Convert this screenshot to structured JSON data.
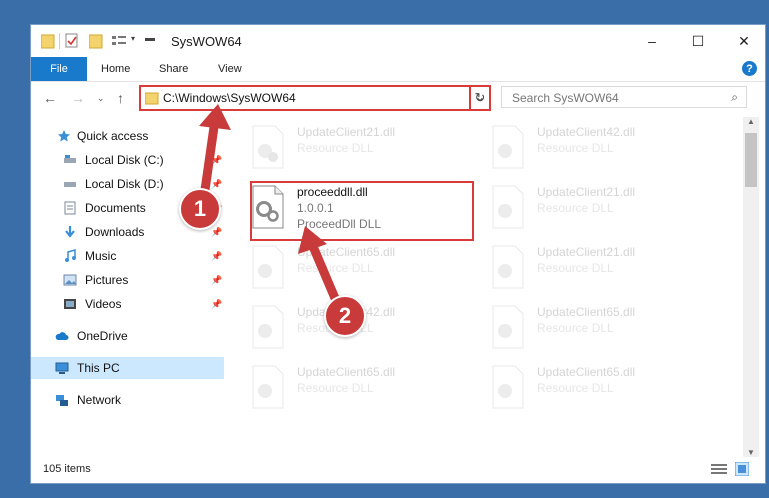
{
  "window": {
    "title": "SysWOW64",
    "minimize": "–",
    "maximize": "☐",
    "close": "✕"
  },
  "ribbon": {
    "file": "File",
    "home": "Home",
    "share": "Share",
    "view": "View",
    "help": "?"
  },
  "address": {
    "path": "C:\\Windows\\SysWOW64",
    "search_placeholder": "Search SysWOW64"
  },
  "sidebar": {
    "items": [
      {
        "label": "Quick access"
      },
      {
        "label": "Local Disk (C:)"
      },
      {
        "label": "Local Disk (D:)"
      },
      {
        "label": "Documents"
      },
      {
        "label": "Downloads"
      },
      {
        "label": "Music"
      },
      {
        "label": "Pictures"
      },
      {
        "label": "Videos"
      },
      {
        "label": "OneDrive"
      },
      {
        "label": "This PC"
      },
      {
        "label": "Network"
      }
    ]
  },
  "files": {
    "left": [
      {
        "name": "UpdateClient21.dll",
        "desc": "Resource DLL"
      },
      {
        "name": "proceeddll.dll",
        "version": "1.0.0.1",
        "desc": "ProceedDll DLL"
      },
      {
        "name": "UpdateClient65.dll",
        "desc": "Resource DLL"
      },
      {
        "name": "UpdateClient42.dll",
        "desc": "Resource DLL"
      },
      {
        "name": "UpdateClient65.dll",
        "desc": "Resource DLL"
      }
    ],
    "right": [
      {
        "name": "UpdateClient42.dll",
        "desc": "Resource DLL"
      },
      {
        "name": "UpdateClient21.dll",
        "desc": "Resource DLL"
      },
      {
        "name": "UpdateClient21.dll",
        "desc": "Resource DLL"
      },
      {
        "name": "UpdateClient65.dll",
        "desc": "Resource DLL"
      },
      {
        "name": "UpdateClient65.dll",
        "desc": "Resource DLL"
      }
    ]
  },
  "status": {
    "count": "105 items"
  },
  "badges": {
    "one": "1",
    "two": "2"
  },
  "colors": {
    "accent": "#1979ca",
    "highlight": "#d93a3a",
    "badge": "#c93a3a"
  }
}
